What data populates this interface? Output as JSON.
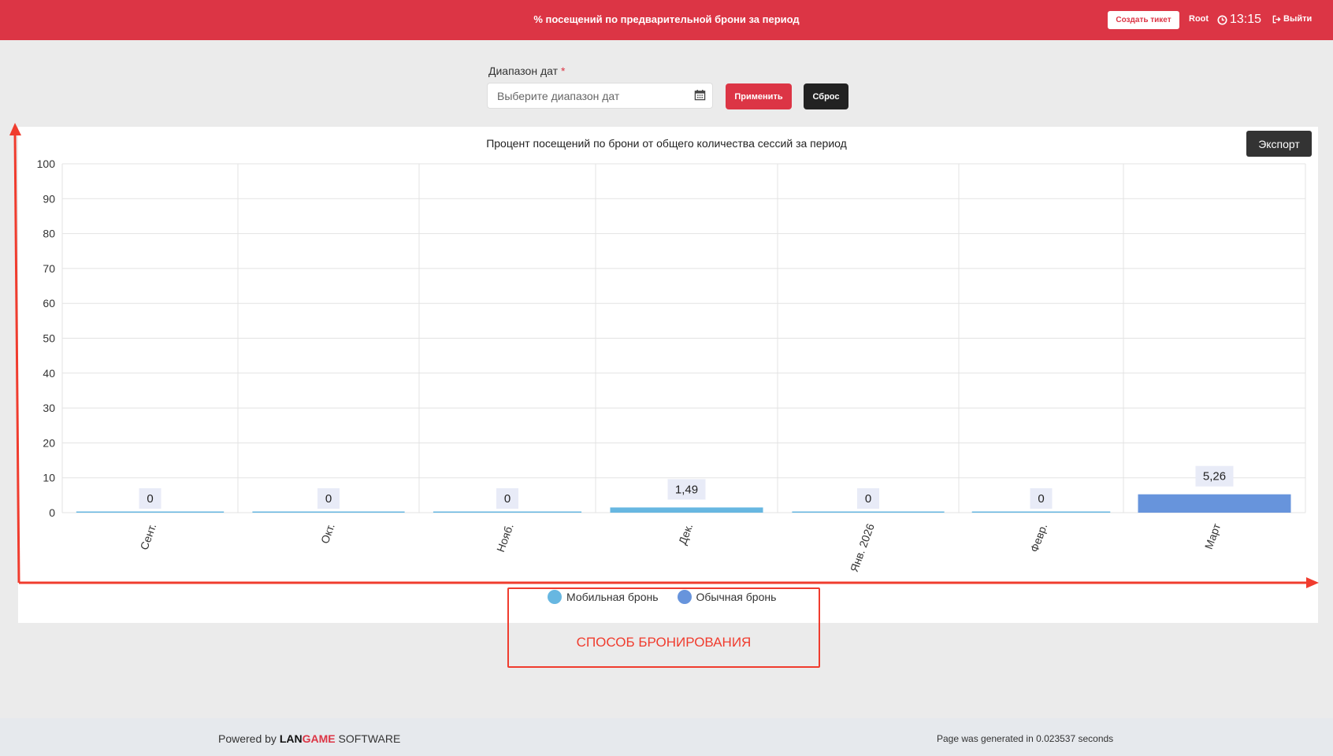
{
  "header": {
    "title": "% посещений по предварительной брони за период",
    "ticket_label": "Создать тикет",
    "user": "Root",
    "time": "13:15",
    "logout_label": "Выйти"
  },
  "filter": {
    "label": "Диапазон дат",
    "required_mark": "*",
    "placeholder": "Выберите диапазон дат",
    "apply_label": "Применить",
    "reset_label": "Сброс"
  },
  "export_label": "Экспорт",
  "annotation": {
    "text": "СПОСОБ БРОНИРОВАНИЯ",
    "color": "#f03c2e"
  },
  "footer": {
    "powered_prefix": "Powered by",
    "brand_lan": "LAN",
    "brand_game": "GAME",
    "brand_suffix": "SOFTWARE",
    "generated": "Page was generated in 0.023537 seconds"
  },
  "colors": {
    "brand": "#dc3545",
    "mobile": "#67b7e1",
    "regular": "#6794dc"
  },
  "chart_data": {
    "type": "bar",
    "title": "Процент посещений по брони от общего количества сессий за период",
    "categories": [
      "Сент.",
      "Окт.",
      "Нояб.",
      "Дек.",
      "Янв. 2026",
      "Февр.",
      "Март"
    ],
    "ylim": [
      0,
      100
    ],
    "yticks": [
      0,
      10,
      20,
      30,
      40,
      50,
      60,
      70,
      80,
      90,
      100
    ],
    "series": [
      {
        "name": "Мобильная бронь",
        "color": "#67b7e1",
        "values": [
          0,
          0,
          0,
          1.49,
          0,
          0,
          0
        ]
      },
      {
        "name": "Обычная бронь",
        "color": "#6794dc",
        "values": [
          0,
          0,
          0,
          0,
          0,
          0,
          5.26
        ]
      }
    ],
    "data_labels": [
      "0",
      "0",
      "0",
      "1,49",
      "0",
      "0",
      "5,26"
    ],
    "legend": "bottom",
    "grid": true
  }
}
